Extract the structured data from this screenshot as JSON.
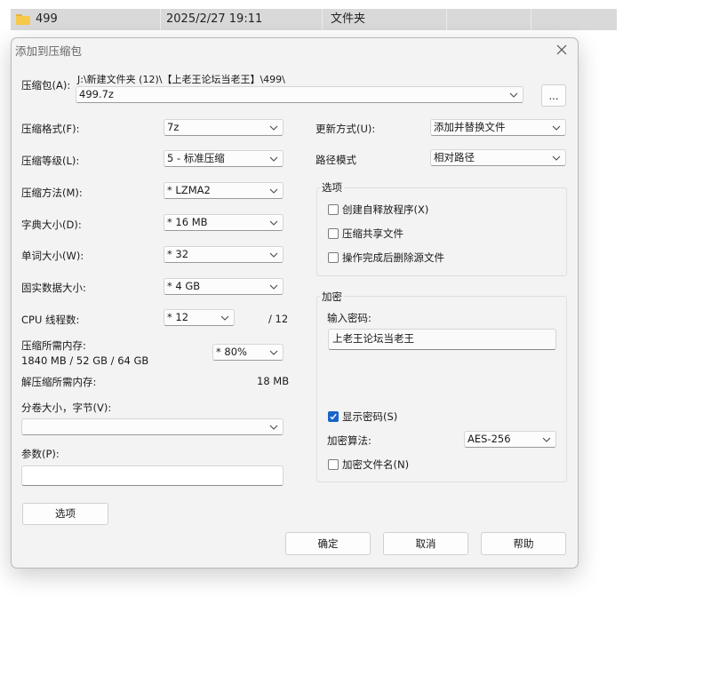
{
  "file_list": {
    "name": "499",
    "date": "2025/2/27 19:11",
    "type": "文件夹"
  },
  "dialog": {
    "title": "添加到压缩包",
    "archive": {
      "label": "压缩包(A):",
      "path": "J:\\新建文件夹 (12)\\【上老王论坛当老王】\\499\\",
      "name": "499.7z",
      "browse_label": "..."
    },
    "left": {
      "format": {
        "label": "压缩格式(F):",
        "value": "7z"
      },
      "level": {
        "label": "压缩等级(L):",
        "value": "5 - 标准压缩"
      },
      "method": {
        "label": "压缩方法(M):",
        "value": "*  LZMA2"
      },
      "dict": {
        "label": "字典大小(D):",
        "value": "*  16 MB"
      },
      "word": {
        "label": "单词大小(W):",
        "value": "*  32"
      },
      "solid": {
        "label": "固实数据大小:",
        "value": "*  4 GB"
      },
      "cpu": {
        "label": "CPU 线程数:",
        "value": "*  12",
        "total": "/ 12"
      },
      "mem_comp": {
        "label": "压缩所需内存:",
        "detail": "1840 MB / 52 GB / 64 GB",
        "value": "*  80%"
      },
      "mem_decomp": {
        "label": "解压缩所需内存:",
        "value": "18 MB"
      },
      "volume": {
        "label": "分卷大小，字节(V):",
        "value": ""
      },
      "params": {
        "label": "参数(P):",
        "value": ""
      },
      "options_button": "选项"
    },
    "right": {
      "update_mode": {
        "label": "更新方式(U):",
        "value": "添加并替换文件"
      },
      "path_mode": {
        "label": "路径模式",
        "value": "相对路径"
      },
      "options_group": {
        "title": "选项",
        "sfx": {
          "label": "创建自释放程序(X)",
          "checked": false
        },
        "shared": {
          "label": "压缩共享文件",
          "checked": false
        },
        "delete_after": {
          "label": "操作完成后删除源文件",
          "checked": false
        }
      },
      "encryption": {
        "title": "加密",
        "password_label": "输入密码:",
        "password_value": "上老王论坛当老王",
        "show_password": {
          "label": "显示密码(S)",
          "checked": true
        },
        "method_label": "加密算法:",
        "method_value": "AES-256",
        "encrypt_names": {
          "label": "加密文件名(N)",
          "checked": false
        }
      }
    },
    "buttons": {
      "ok": "确定",
      "cancel": "取消",
      "help": "帮助"
    }
  },
  "colors": {
    "accent": "#1a63c8",
    "dialog_bg": "#f3f3f3",
    "row_highlight": "#d9d9d9",
    "folder": "#f7c94b"
  }
}
